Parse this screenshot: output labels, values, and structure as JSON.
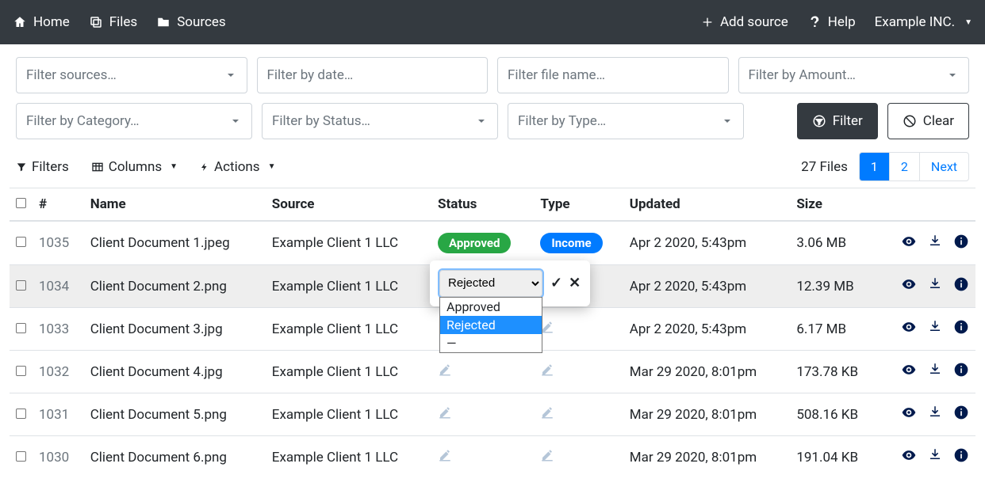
{
  "nav": {
    "home": "Home",
    "files": "Files",
    "sources": "Sources",
    "add_source": "Add source",
    "help": "Help",
    "account": "Example INC."
  },
  "filters": {
    "sources": "Filter sources…",
    "date": "Filter by date…",
    "filename": "Filter file name…",
    "amount": "Filter by Amount…",
    "category": "Filter by Category…",
    "status": "Filter by Status…",
    "type": "Filter by Type…",
    "filter_btn": "Filter",
    "clear_btn": "Clear"
  },
  "toolbar": {
    "filters": "Filters",
    "columns": "Columns",
    "actions": "Actions",
    "files_count": "27 Files",
    "page1": "1",
    "page2": "2",
    "next": "Next"
  },
  "headers": {
    "num": "#",
    "name": "Name",
    "source": "Source",
    "status": "Status",
    "type": "Type",
    "updated": "Updated",
    "size": "Size"
  },
  "status_options": {
    "approved": "Approved",
    "rejected": "Rejected",
    "blank": "—"
  },
  "popover": {
    "selected": "Rejected"
  },
  "rows": [
    {
      "id": "1035",
      "name": "Client Document 1.jpeg",
      "source": "Example Client 1 LLC",
      "status": "Approved",
      "type": "Income",
      "updated": "Apr 2 2020, 5:43pm",
      "size": "3.06 MB"
    },
    {
      "id": "1034",
      "name": "Client Document 2.png",
      "source": "Example Client 1 LLC",
      "status": "",
      "type": "",
      "updated": "Apr 2 2020, 5:43pm",
      "size": "12.39 MB"
    },
    {
      "id": "1033",
      "name": "Client Document 3.jpg",
      "source": "Example Client 1 LLC",
      "status": "",
      "type": "",
      "updated": "Apr 2 2020, 5:43pm",
      "size": "6.17 MB"
    },
    {
      "id": "1032",
      "name": "Client Document 4.jpg",
      "source": "Example Client 1 LLC",
      "status": "",
      "type": "",
      "updated": "Mar 29 2020, 8:01pm",
      "size": "173.78 KB"
    },
    {
      "id": "1031",
      "name": "Client Document 5.png",
      "source": "Example Client 1 LLC",
      "status": "",
      "type": "",
      "updated": "Mar 29 2020, 8:01pm",
      "size": "508.16 KB"
    },
    {
      "id": "1030",
      "name": "Client Document 6.png",
      "source": "Example Client 1 LLC",
      "status": "",
      "type": "",
      "updated": "Mar 29 2020, 8:01pm",
      "size": "191.04 KB"
    }
  ]
}
